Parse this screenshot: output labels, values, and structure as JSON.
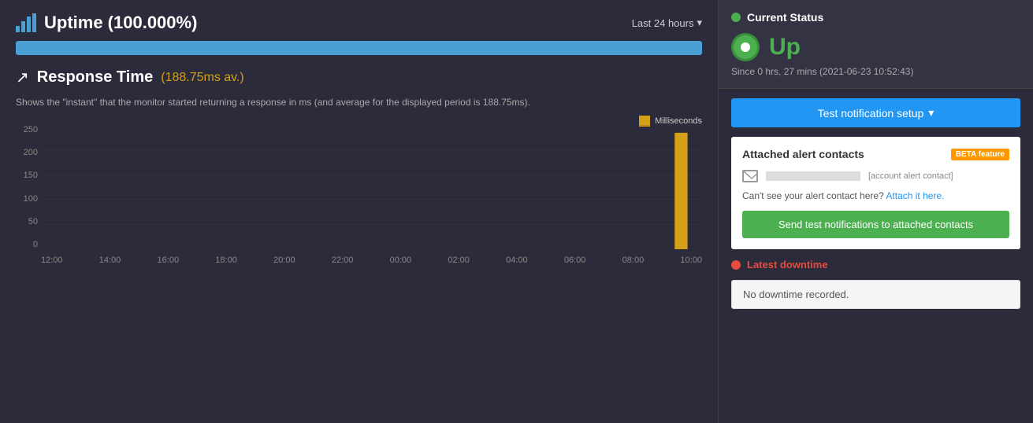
{
  "header": {
    "uptime_icon": "bar-chart-icon",
    "uptime_title": "Uptime (100.000%)",
    "last24_label": "Last 24 hours",
    "progress_pct": 100
  },
  "response_time": {
    "icon": "trend-icon",
    "title": "Response Time",
    "avg_label": "(188.75ms av.)",
    "description": "Shows the \"instant\" that the monitor started returning a response in ms (and average for the displayed period is 188.75ms).",
    "legend_label": "Milliseconds"
  },
  "chart": {
    "y_labels": [
      "250",
      "200",
      "150",
      "100",
      "50",
      "0"
    ],
    "x_labels": [
      "12:00",
      "14:00",
      "16:00",
      "18:00",
      "20:00",
      "22:00",
      "00:00",
      "02:00",
      "04:00",
      "06:00",
      "08:00",
      "10:00"
    ]
  },
  "current_status": {
    "title": "Current Status",
    "status": "Up",
    "since_label": "Since 0 hrs, 27 mins (2021-06-23 10:52:43)"
  },
  "test_notification": {
    "button_label": "Test notification setup",
    "dropdown_icon": "chevron-down-icon"
  },
  "attached_contacts": {
    "title": "Attached alert contacts",
    "beta_label": "BETA feature",
    "contact_label": "[account alert contact]",
    "cant_see_text": "Can't see your alert contact here?",
    "attach_link_text": "Attach it here.",
    "send_test_label": "Send test notifications to attached contacts"
  },
  "latest_downtime": {
    "title": "Latest downtime",
    "no_downtime_text": "No downtime recorded."
  }
}
